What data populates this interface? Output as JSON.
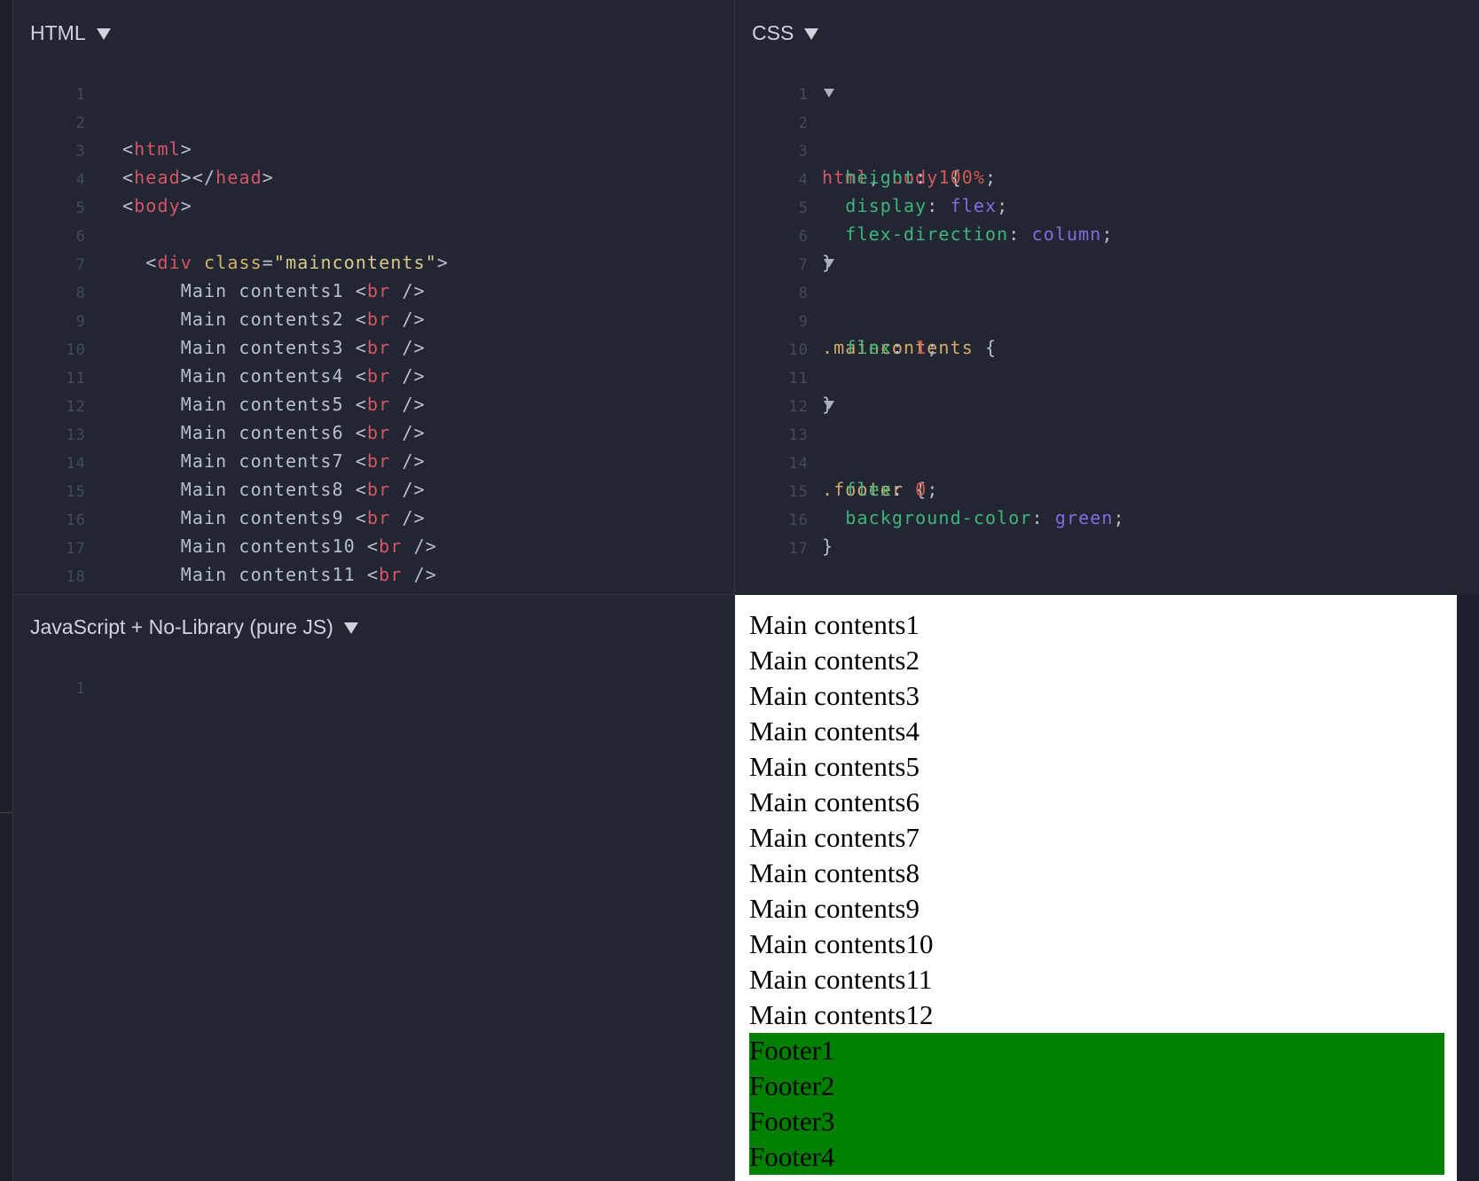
{
  "panes": {
    "html": {
      "title": "HTML"
    },
    "css": {
      "title": "CSS"
    },
    "js": {
      "title": "JavaScript + No-Library (pure JS)"
    }
  },
  "html_code": {
    "line_numbers": [
      "1",
      "2",
      "3",
      "4",
      "5",
      "6",
      "7",
      "8",
      "9",
      "10",
      "11",
      "12",
      "13",
      "14",
      "15",
      "16",
      "17",
      "18"
    ],
    "main_label": "Main contents",
    "main_numbers": [
      "1",
      "2",
      "3",
      "4",
      "5",
      "6",
      "7",
      "8",
      "9",
      "10",
      "11"
    ],
    "html_tag": "html",
    "head_tag": "head",
    "body_tag": "body",
    "div_tag": "div",
    "class_attr": "class",
    "class_value": "\"maincontents\"",
    "br_tag": "br"
  },
  "css_code": {
    "line_numbers": [
      "1",
      "2",
      "3",
      "4",
      "5",
      "6",
      "7",
      "8",
      "9",
      "10",
      "11",
      "12",
      "13",
      "14",
      "15",
      "16",
      "17"
    ],
    "rule1_selector_a": "html",
    "rule1_selector_b": "body",
    "height_prop": "height",
    "height_val": "100%",
    "display_prop": "display",
    "display_val": "flex",
    "flexdir_prop": "flex-direction",
    "flexdir_val": "column",
    "rule2_selector": ".maincontents",
    "flex_prop": "flex",
    "flex_val_1": "1",
    "rule3_selector": ".footer",
    "flex_val_0": "0",
    "bg_prop": "background-color",
    "bg_val": "green"
  },
  "js_code": {
    "line_numbers": [
      "1"
    ]
  },
  "result": {
    "main_items": [
      "Main contents1",
      "Main contents2",
      "Main contents3",
      "Main contents4",
      "Main contents5",
      "Main contents6",
      "Main contents7",
      "Main contents8",
      "Main contents9",
      "Main contents10",
      "Main contents11",
      "Main contents12"
    ],
    "footer_items": [
      "Footer1",
      "Footer2",
      "Footer3",
      "Footer4"
    ],
    "footer_color": "#008000"
  }
}
